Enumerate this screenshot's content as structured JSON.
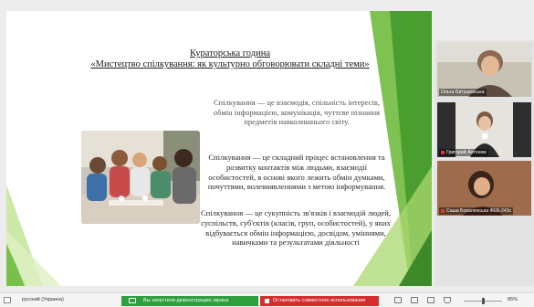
{
  "slide": {
    "title_line1": "Кураторська година",
    "title_line2": "«Мистецтво спілкування: як культурно обговорювати складні теми»",
    "paragraph1": "Спілкування — це взаємодія, спільність інтересів, обмін інформацією, комунікація, чуттєве пізнання предметів навколишнього світу.",
    "paragraph2": "Спілкування — це складний процес встановлення та розвитку контактів між людьми, взаємодії особистостей, в основі якого лежить обмін думками, почуттями, волевиявленнями з метою інформування.",
    "paragraph3": "Спілкування — це сукупність зв'язків і взаємодій людей, суспільств, суб'єктів (класів, груп, особистостей), у яких відбувається обмін інформацією, досвідом, уміннями, навичками та результатами діяльності"
  },
  "participants": [
    {
      "name": "Ольга Євтушевська"
    },
    {
      "name": "Григорий Антонюк"
    },
    {
      "name": "Саша Бокалянська ФЕБ-243с"
    }
  ],
  "taskbar": {
    "language": "русский (Украина)",
    "share_label": "Вы запустили демонстрацию экрана",
    "stop_label": "Остановить совместное использование",
    "zoom": "85%"
  },
  "colors": {
    "slide_green_dark": "#4a9e2f",
    "slide_green_light": "#a9d76f",
    "share_green": "#2e9e3e",
    "stop_red": "#d32f2f"
  }
}
